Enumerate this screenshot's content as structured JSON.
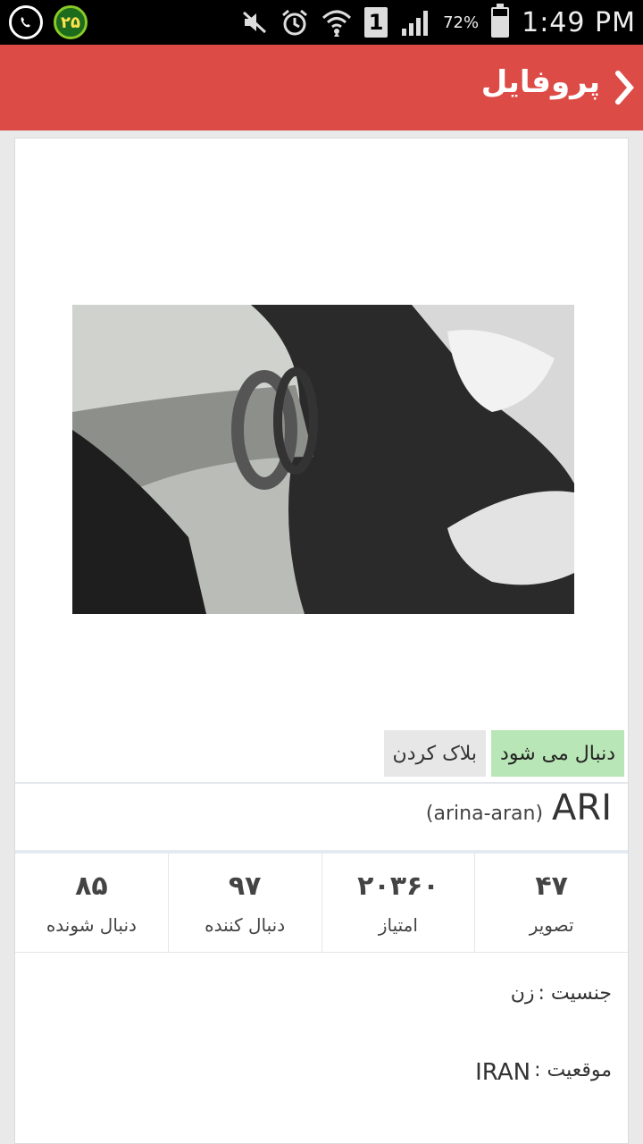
{
  "status_bar": {
    "notification_badge": "۲۵",
    "sim_slot": "1",
    "battery_percent": "72%",
    "battery_level": 0.72,
    "time": "1:49 PM",
    "icons": [
      "whatsapp-icon",
      "mute-icon",
      "alarm-icon",
      "wifi-icon",
      "signal-icon",
      "battery-icon"
    ]
  },
  "app_bar": {
    "title": "پروفایل",
    "color": "#dd4b46"
  },
  "actions": {
    "follow_label": "دنبال می شود",
    "block_label": "بلاک کردن"
  },
  "profile": {
    "display_name": "ARI",
    "username": "(arina-aran)"
  },
  "stats": [
    {
      "value": "۴۷",
      "label": "تصویر"
    },
    {
      "value": "۲۰۳۶۰",
      "label": "امتیاز"
    },
    {
      "value": "۹۷",
      "label": "دنبال کننده"
    },
    {
      "value": "۸۵",
      "label": "دنبال شونده"
    }
  ],
  "info": {
    "gender_label": "جنسیت :",
    "gender_value": "زن",
    "location_label": "موقعیت :",
    "location_value": "IRAN"
  }
}
